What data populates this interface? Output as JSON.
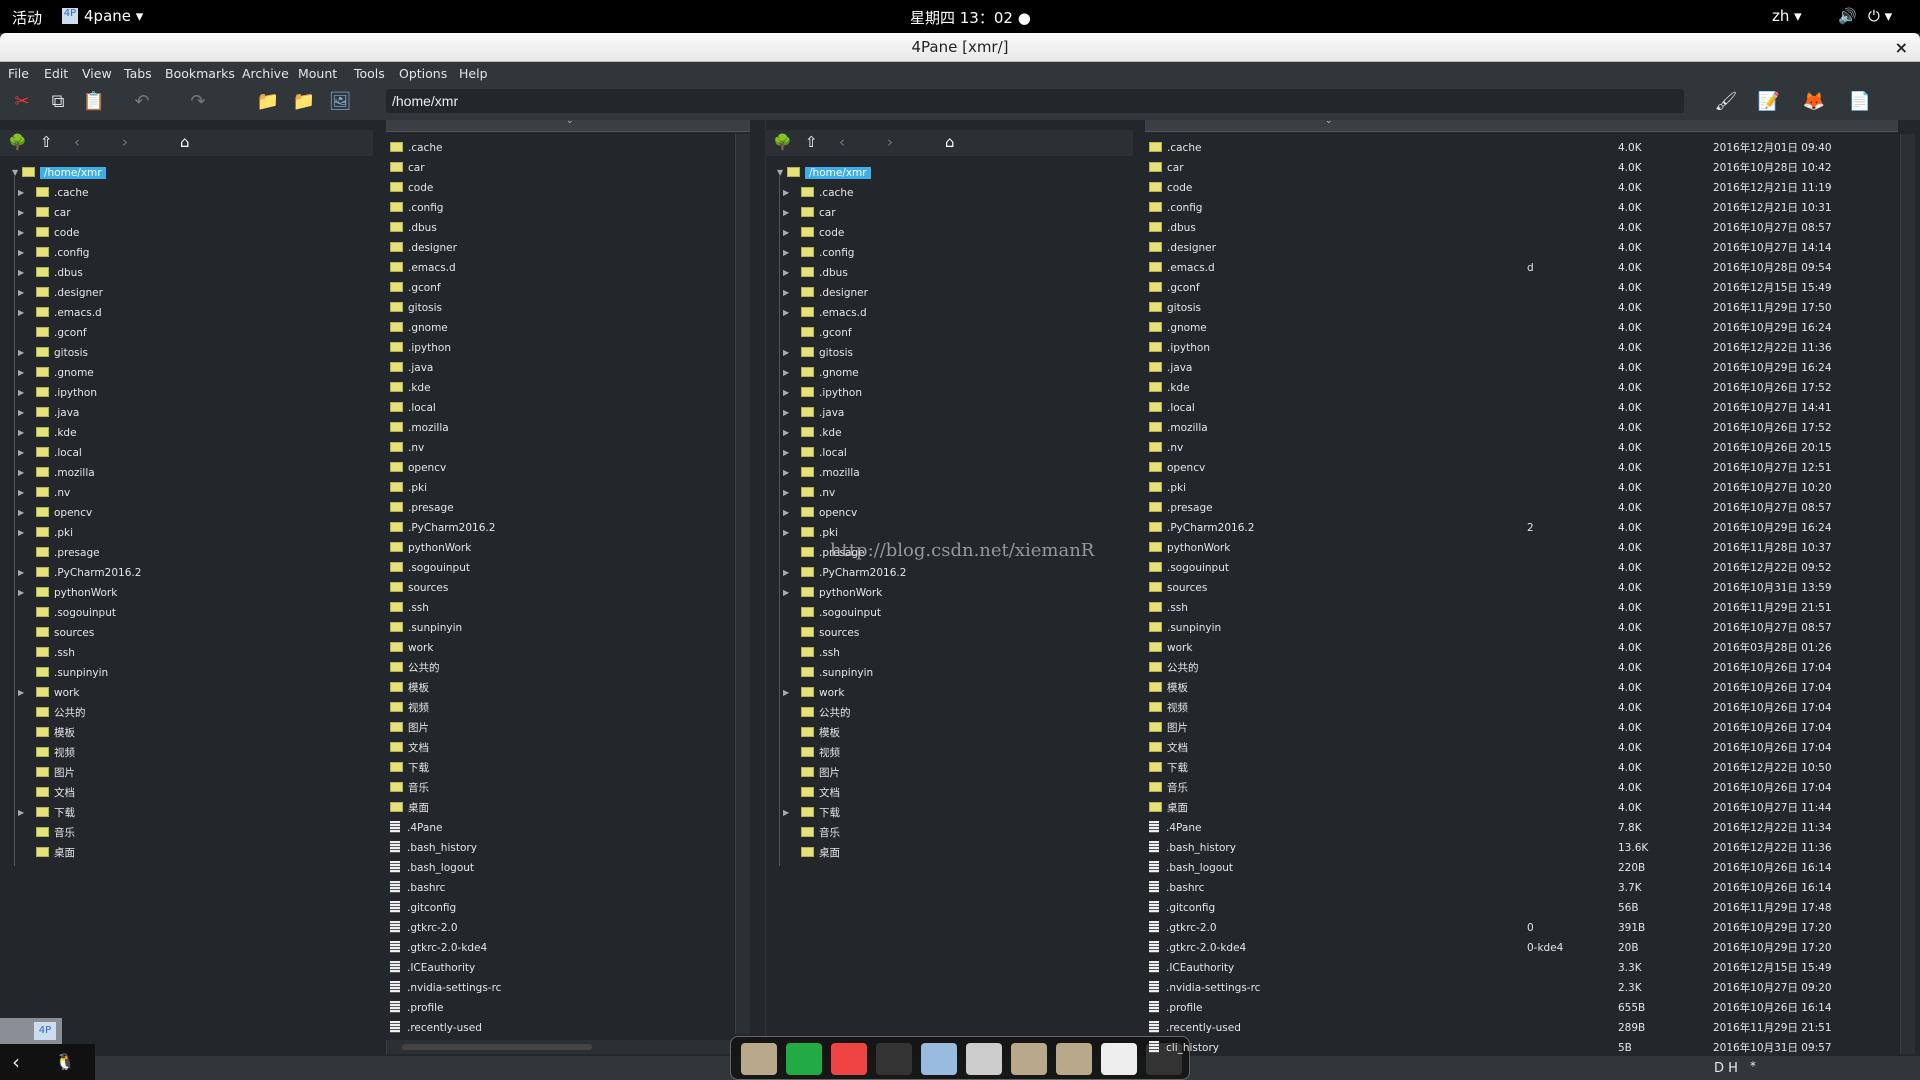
{
  "topbar": {
    "activities": "活动",
    "app": "4pane ▾",
    "clock": "星期四 13：02 ●",
    "lang": "zh ▾",
    "volume_icon": "🔊",
    "power_icon": "⏻ ▾"
  },
  "window": {
    "title": "4Pane [xmr/]",
    "close": "×"
  },
  "menu": [
    "File",
    "Edit",
    "View",
    "Tabs",
    "Bookmarks",
    "Archive",
    "Mount",
    "Tools",
    "Options",
    "Help"
  ],
  "toolbar": {
    "icons": [
      "cut-icon",
      "copy-icon",
      "paste-icon",
      "undo-icon",
      "redo-icon",
      "new-folder-icon",
      "delete-folder-icon",
      "image-icon"
    ],
    "right_icons": [
      "kate-icon",
      "editor-icon",
      "firefox-icon",
      "new-file-icon"
    ],
    "path": "/home/xmr"
  },
  "tree": {
    "root": "/home/xmr",
    "items": [
      [
        "cache",
        ".cache",
        1
      ],
      [
        "car",
        "car",
        1
      ],
      [
        "code",
        "code",
        1
      ],
      [
        "config",
        ".config",
        1
      ],
      [
        "dbus",
        ".dbus",
        1
      ],
      [
        "designer",
        ".designer",
        1
      ],
      [
        "emacs",
        ".emacs.d",
        1
      ],
      [
        "gconf",
        ".gconf",
        0
      ],
      [
        "gitosis",
        "gitosis",
        1
      ],
      [
        "gnome",
        ".gnome",
        1
      ],
      [
        "ipython",
        ".ipython",
        1
      ],
      [
        "java",
        ".java",
        1
      ],
      [
        "kde",
        ".kde",
        1
      ],
      [
        "local",
        ".local",
        1
      ],
      [
        "mozilla",
        ".mozilla",
        1
      ],
      [
        "nv",
        ".nv",
        1
      ],
      [
        "opencv",
        "opencv",
        1
      ],
      [
        "pki",
        ".pki",
        1
      ],
      [
        "presage",
        ".presage",
        0
      ],
      [
        "pycharm",
        ".PyCharm2016.2",
        1
      ],
      [
        "pythonwork",
        "pythonWork",
        1
      ],
      [
        "sogou",
        ".sogouinput",
        0
      ],
      [
        "sources",
        "sources",
        0
      ],
      [
        "ssh",
        ".ssh",
        0
      ],
      [
        "sunpinyin",
        ".sunpinyin",
        0
      ],
      [
        "work",
        "work",
        1
      ],
      [
        "public",
        "公共的",
        0
      ],
      [
        "templates",
        "模板",
        0
      ],
      [
        "videos",
        "视频",
        0
      ],
      [
        "pictures",
        "图片",
        0
      ],
      [
        "docs",
        "文档",
        0
      ],
      [
        "downloads",
        "下载",
        1
      ],
      [
        "music",
        "音乐",
        0
      ],
      [
        "desktop",
        "桌面",
        0
      ]
    ]
  },
  "files": [
    {
      "name": ".cache",
      "ext": "",
      "size": "4.0K",
      "date": "2016年12月01日 09:40",
      "dir": true
    },
    {
      "name": "car",
      "ext": "",
      "size": "4.0K",
      "date": "2016年10月28日 10:42",
      "dir": true
    },
    {
      "name": "code",
      "ext": "",
      "size": "4.0K",
      "date": "2016年12月21日 11:19",
      "dir": true
    },
    {
      "name": ".config",
      "ext": "",
      "size": "4.0K",
      "date": "2016年12月21日 10:31",
      "dir": true
    },
    {
      "name": ".dbus",
      "ext": "",
      "size": "4.0K",
      "date": "2016年10月27日 08:57",
      "dir": true
    },
    {
      "name": ".designer",
      "ext": "",
      "size": "4.0K",
      "date": "2016年10月27日 14:14",
      "dir": true
    },
    {
      "name": ".emacs.d",
      "ext": "d",
      "size": "4.0K",
      "date": "2016年10月28日 09:54",
      "dir": true
    },
    {
      "name": ".gconf",
      "ext": "",
      "size": "4.0K",
      "date": "2016年12月15日 15:49",
      "dir": true
    },
    {
      "name": "gitosis",
      "ext": "",
      "size": "4.0K",
      "date": "2016年11月29日 17:50",
      "dir": true
    },
    {
      "name": ".gnome",
      "ext": "",
      "size": "4.0K",
      "date": "2016年10月29日 16:24",
      "dir": true
    },
    {
      "name": ".ipython",
      "ext": "",
      "size": "4.0K",
      "date": "2016年12月22日 11:36",
      "dir": true
    },
    {
      "name": ".java",
      "ext": "",
      "size": "4.0K",
      "date": "2016年10月29日 16:24",
      "dir": true
    },
    {
      "name": ".kde",
      "ext": "",
      "size": "4.0K",
      "date": "2016年10月26日 17:52",
      "dir": true
    },
    {
      "name": ".local",
      "ext": "",
      "size": "4.0K",
      "date": "2016年10月27日 14:41",
      "dir": true
    },
    {
      "name": ".mozilla",
      "ext": "",
      "size": "4.0K",
      "date": "2016年10月26日 17:52",
      "dir": true
    },
    {
      "name": ".nv",
      "ext": "",
      "size": "4.0K",
      "date": "2016年10月26日 20:15",
      "dir": true
    },
    {
      "name": "opencv",
      "ext": "",
      "size": "4.0K",
      "date": "2016年10月27日 12:51",
      "dir": true
    },
    {
      "name": ".pki",
      "ext": "",
      "size": "4.0K",
      "date": "2016年10月27日 10:20",
      "dir": true
    },
    {
      "name": ".presage",
      "ext": "",
      "size": "4.0K",
      "date": "2016年10月27日 08:57",
      "dir": true
    },
    {
      "name": ".PyCharm2016.2",
      "ext": "2",
      "size": "4.0K",
      "date": "2016年10月29日 16:24",
      "dir": true
    },
    {
      "name": "pythonWork",
      "ext": "",
      "size": "4.0K",
      "date": "2016年11月28日 10:37",
      "dir": true
    },
    {
      "name": ".sogouinput",
      "ext": "",
      "size": "4.0K",
      "date": "2016年12月22日 09:52",
      "dir": true
    },
    {
      "name": "sources",
      "ext": "",
      "size": "4.0K",
      "date": "2016年10月31日 13:59",
      "dir": true
    },
    {
      "name": ".ssh",
      "ext": "",
      "size": "4.0K",
      "date": "2016年11月29日 21:51",
      "dir": true
    },
    {
      "name": ".sunpinyin",
      "ext": "",
      "size": "4.0K",
      "date": "2016年10月27日 08:57",
      "dir": true
    },
    {
      "name": "work",
      "ext": "",
      "size": "4.0K",
      "date": "2016年03月28日 01:26",
      "dir": true
    },
    {
      "name": "公共的",
      "ext": "",
      "size": "4.0K",
      "date": "2016年10月26日 17:04",
      "dir": true
    },
    {
      "name": "模板",
      "ext": "",
      "size": "4.0K",
      "date": "2016年10月26日 17:04",
      "dir": true
    },
    {
      "name": "视频",
      "ext": "",
      "size": "4.0K",
      "date": "2016年10月26日 17:04",
      "dir": true
    },
    {
      "name": "图片",
      "ext": "",
      "size": "4.0K",
      "date": "2016年10月26日 17:04",
      "dir": true
    },
    {
      "name": "文档",
      "ext": "",
      "size": "4.0K",
      "date": "2016年10月26日 17:04",
      "dir": true
    },
    {
      "name": "下载",
      "ext": "",
      "size": "4.0K",
      "date": "2016年12月22日 10:50",
      "dir": true
    },
    {
      "name": "音乐",
      "ext": "",
      "size": "4.0K",
      "date": "2016年10月26日 17:04",
      "dir": true
    },
    {
      "name": "桌面",
      "ext": "",
      "size": "4.0K",
      "date": "2016年10月27日 11:44",
      "dir": true
    },
    {
      "name": ".4Pane",
      "ext": "",
      "size": "7.8K",
      "date": "2016年12月22日 11:34",
      "dir": false
    },
    {
      "name": ".bash_history",
      "ext": "",
      "size": "13.6K",
      "date": "2016年12月22日 11:36",
      "dir": false
    },
    {
      "name": ".bash_logout",
      "ext": "",
      "size": "220B",
      "date": "2016年10月26日 16:14",
      "dir": false
    },
    {
      "name": ".bashrc",
      "ext": "",
      "size": "3.7K",
      "date": "2016年10月26日 16:14",
      "dir": false
    },
    {
      "name": ".gitconfig",
      "ext": "",
      "size": "56B",
      "date": "2016年11月29日 17:48",
      "dir": false
    },
    {
      "name": ".gtkrc-2.0",
      "ext": "0",
      "size": "391B",
      "date": "2016年10月29日 17:20",
      "dir": false
    },
    {
      "name": ".gtkrc-2.0-kde4",
      "ext": "0-kde4",
      "size": "20B",
      "date": "2016年10月29日 17:20",
      "dir": false
    },
    {
      "name": ".ICEauthority",
      "ext": "",
      "size": "3.3K",
      "date": "2016年12月15日 15:49",
      "dir": false
    },
    {
      "name": ".nvidia-settings-rc",
      "ext": "",
      "size": "2.3K",
      "date": "2016年10月27日 09:20",
      "dir": false
    },
    {
      "name": ".profile",
      "ext": "",
      "size": "655B",
      "date": "2016年10月26日 16:14",
      "dir": false
    },
    {
      "name": ".recently-used",
      "ext": "",
      "size": "289B",
      "date": "2016年11月29日 21:51",
      "dir": false
    },
    {
      "name": "cli_history",
      "ext": "",
      "size": "5B",
      "date": "2016年10月31日 09:57",
      "dir": false
    }
  ],
  "watermark": "http://blog.csdn.net/xiemanR",
  "status": {
    "right": "D H",
    "star": "*"
  },
  "dock": [
    "home-folder",
    "pycharm",
    "chrome",
    "terminals",
    "4pane",
    "file-cabinet",
    "docs-folder",
    "d-folder",
    "switch",
    "terminal"
  ],
  "colors": {
    "selection": "#3daee9",
    "folder": "#e6e27a",
    "bg": "#23272b"
  }
}
